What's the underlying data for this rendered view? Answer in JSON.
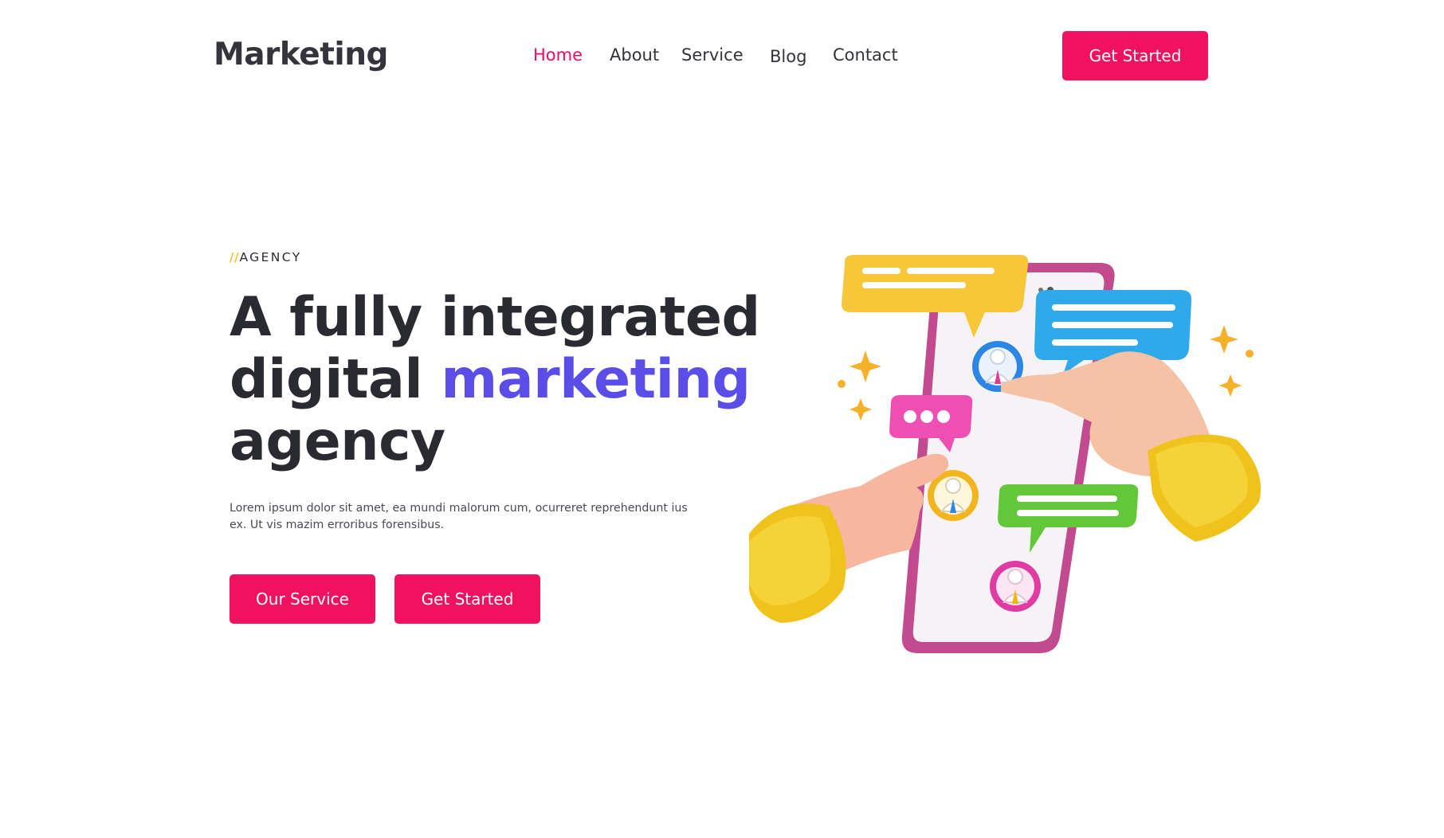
{
  "header": {
    "logo": "Marketing",
    "nav": [
      {
        "label": "Home",
        "active": true
      },
      {
        "label": "About",
        "active": false
      },
      {
        "label": "Service",
        "active": false
      },
      {
        "label": "Blog",
        "active": false
      },
      {
        "label": "Contact",
        "active": false
      }
    ],
    "cta_label": "Get Started"
  },
  "hero": {
    "eyebrow_prefix": "//",
    "eyebrow": "AGENCY",
    "headline_line1": "A fully integrated",
    "headline_line2_plain": "digital ",
    "headline_line2_accent": "marketing",
    "headline_line3": "agency",
    "description": "Lorem ipsum dolor sit amet, ea mundi malorum cum, ocurreret reprehendunt ius ex. Ut vis mazim erroribus forensibus.",
    "primary_button": "Our Service",
    "secondary_button": "Get Started"
  },
  "colors": {
    "brand": "#f0125f",
    "accent": "#5b4ee8",
    "text": "#2b2b33",
    "eyebrow_slashes": "#f5b400"
  },
  "illustration": {
    "icon": "phone-chat-hands-illustration"
  }
}
